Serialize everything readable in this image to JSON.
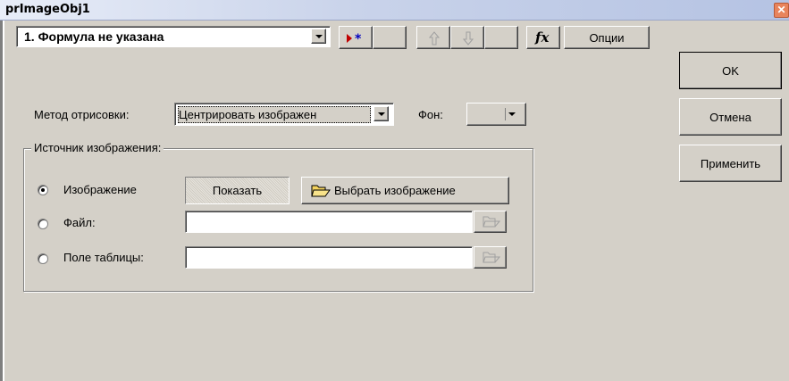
{
  "window": {
    "title": "prImageObj1",
    "close_glyph": "✕"
  },
  "formula_combo": {
    "value": "1.  Формула не указана"
  },
  "toolbar": {
    "options_label": "Опции",
    "fx_label": "fx"
  },
  "buttons": {
    "ok": "OK",
    "cancel": "Отмена",
    "apply": "Применить"
  },
  "draw_method": {
    "label": "Метод отрисовки:",
    "value": "Центрировать изображен"
  },
  "background": {
    "label": "Фон:"
  },
  "source_group": {
    "title": "Источник изображения:",
    "image_label": "Изображение",
    "show_label": "Показать",
    "choose_label": "Выбрать изображение",
    "file_label": "Файл:",
    "table_label": "Поле таблицы:"
  },
  "icons": {
    "add": "add-record-icon",
    "up": "arrow-up-icon",
    "down": "arrow-down-icon",
    "folder": "folder-open-icon"
  },
  "colors": {
    "accent": "#e8845c",
    "dialog": "#d4d0c8"
  }
}
